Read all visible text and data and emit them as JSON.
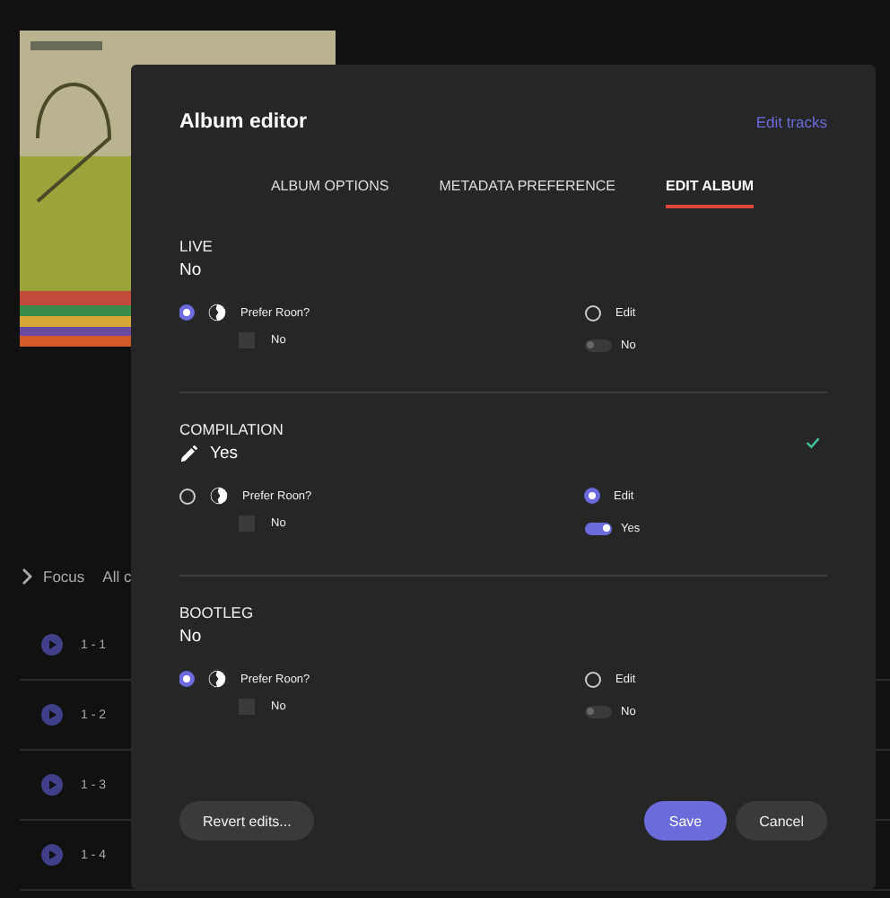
{
  "background": {
    "focus_bar": {
      "focus": "Focus",
      "filter": "All c"
    },
    "tracks": [
      {
        "number": "1 - 1"
      },
      {
        "number": "1 - 2"
      },
      {
        "number": "1 - 3"
      },
      {
        "number": "1 - 4"
      }
    ]
  },
  "dialog": {
    "title": "Album editor",
    "link": "Edit tracks",
    "tabs": [
      {
        "label": "ALBUM OPTIONS",
        "selected": false
      },
      {
        "label": "METADATA PREFERENCE",
        "selected": false
      },
      {
        "label": "EDIT ALBUM",
        "selected": true
      }
    ],
    "sections": [
      {
        "label": "LIVE",
        "value": "No",
        "edited": false,
        "prefer_label": "Prefer Roon?",
        "prefer_selected": true,
        "roon_checked": false,
        "roon_value": "No",
        "edit_label": "Edit",
        "edit_selected": false,
        "edit_on": false,
        "edit_value": "No"
      },
      {
        "label": "COMPILATION",
        "value": "Yes",
        "edited": true,
        "prefer_label": "Prefer Roon?",
        "prefer_selected": false,
        "roon_checked": false,
        "roon_value": "No",
        "edit_label": "Edit",
        "edit_selected": true,
        "edit_on": true,
        "edit_value": "Yes"
      },
      {
        "label": "BOOTLEG",
        "value": "No",
        "edited": false,
        "prefer_label": "Prefer Roon?",
        "prefer_selected": true,
        "roon_checked": false,
        "roon_value": "No",
        "edit_label": "Edit",
        "edit_selected": false,
        "edit_on": false,
        "edit_value": "No"
      }
    ],
    "buttons": {
      "revert": "Revert edits...",
      "save": "Save",
      "cancel": "Cancel"
    }
  }
}
